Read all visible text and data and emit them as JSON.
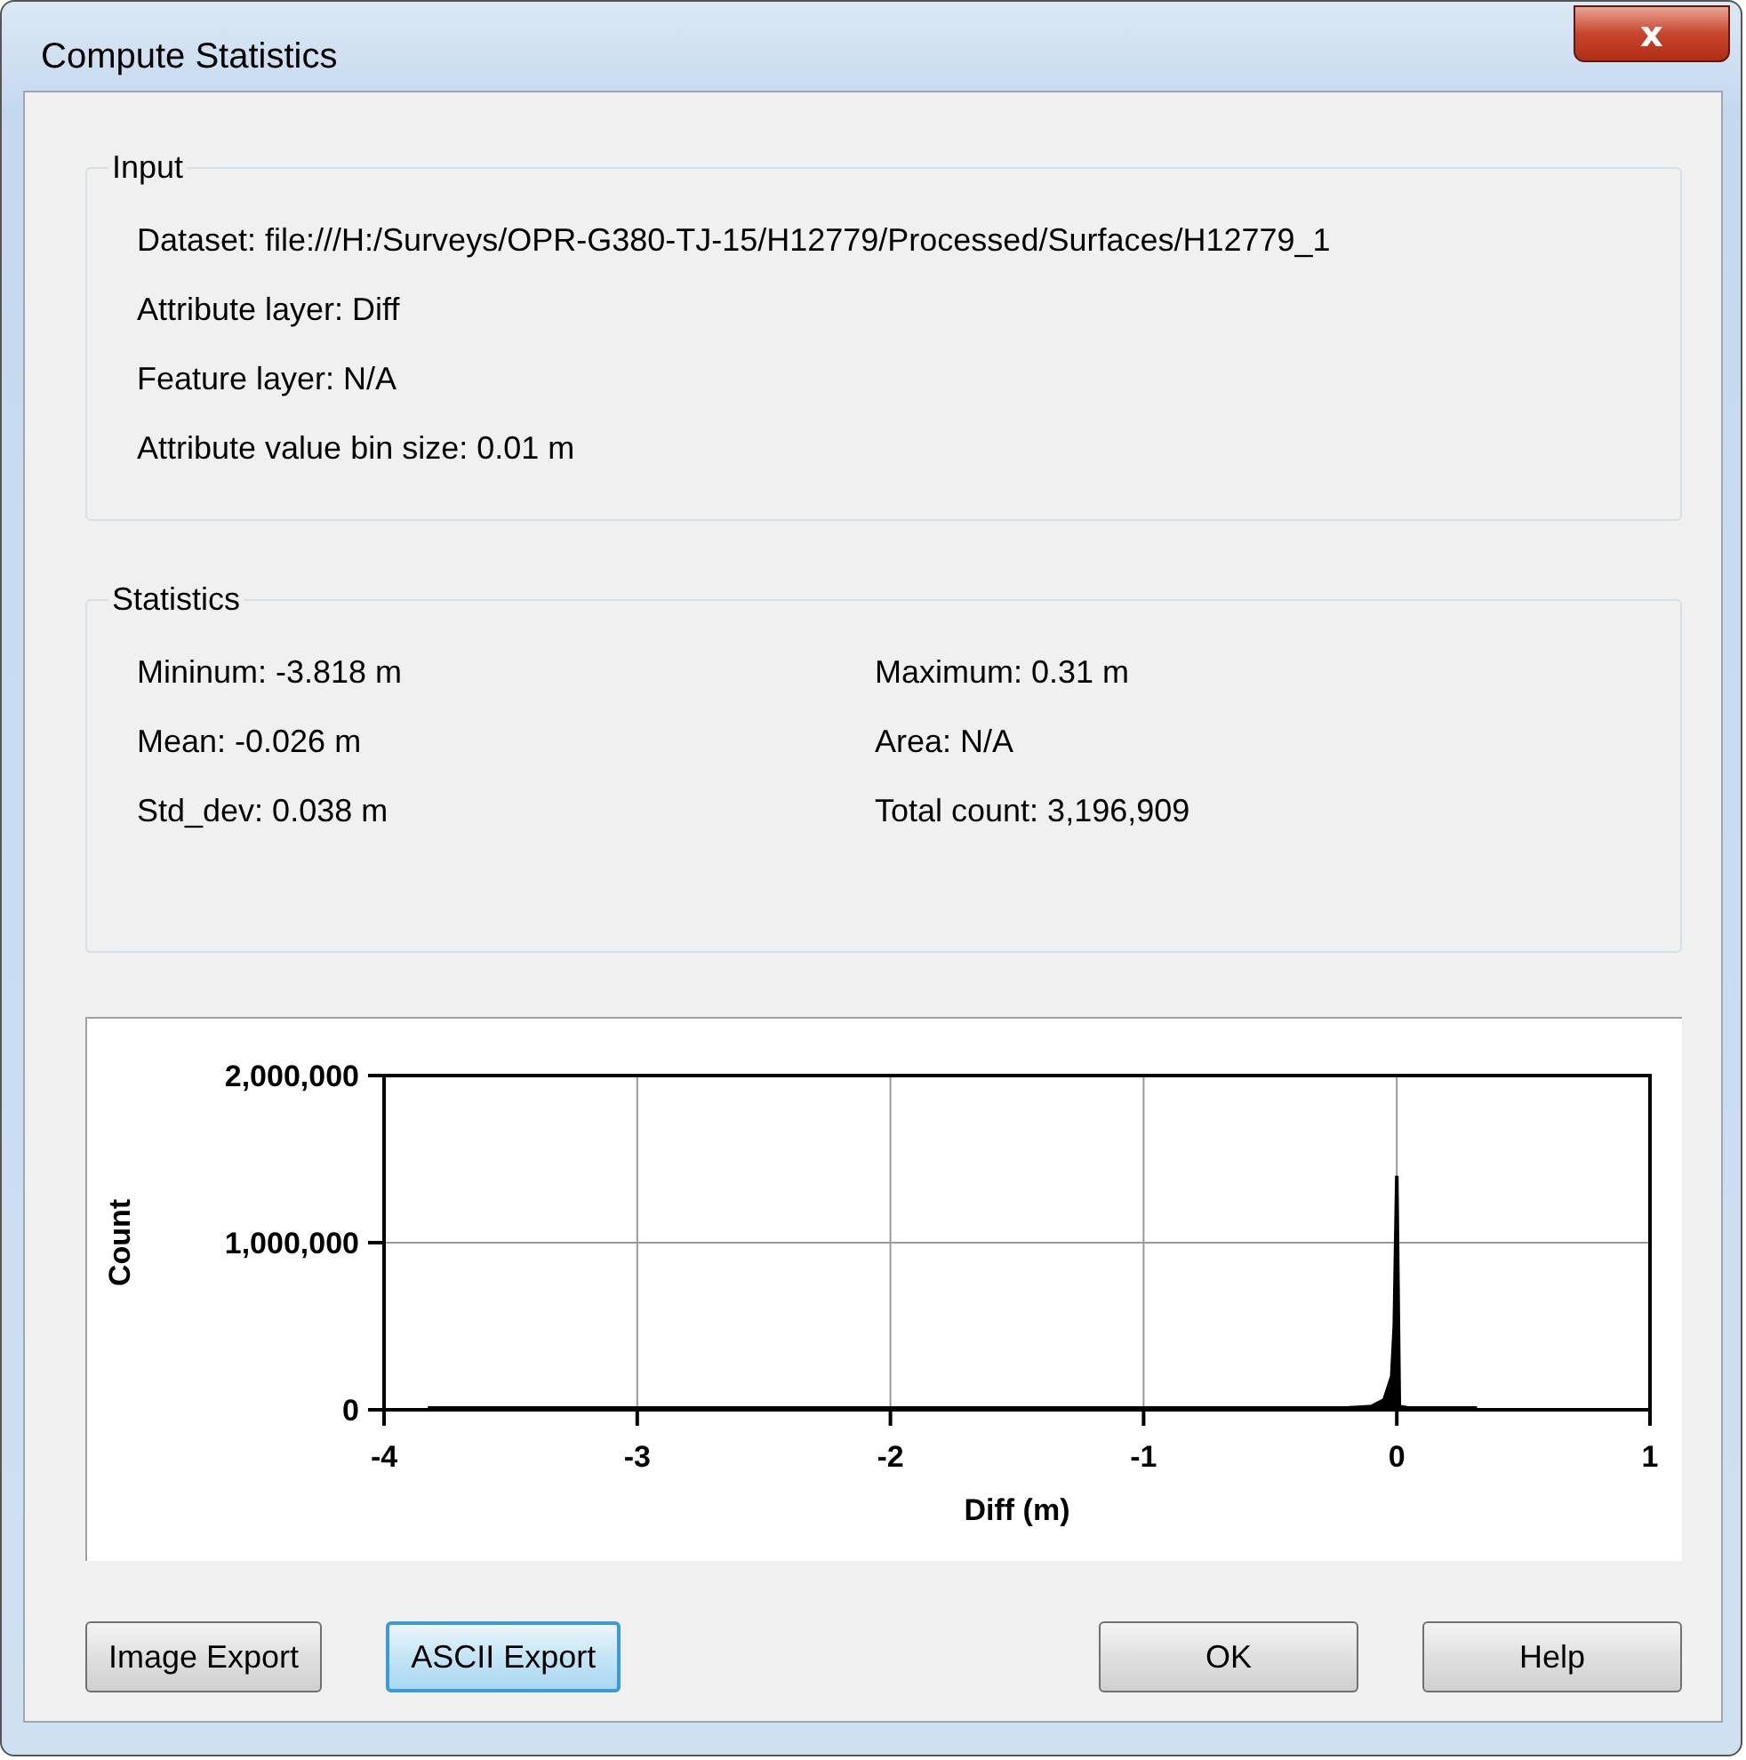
{
  "window": {
    "title": "Compute Statistics",
    "close_label": "x"
  },
  "input": {
    "title": "Input",
    "fields": [
      {
        "label": "Dataset:",
        "value": "file:///H:/Surveys/OPR-G380-TJ-15/H12779/Processed/Surfaces/H12779_1"
      },
      {
        "label": "Attribute layer:",
        "value": "Diff"
      },
      {
        "label": "Feature layer:",
        "value": "N/A"
      },
      {
        "label": "Attribute value bin size:",
        "value": "0.01 m"
      }
    ]
  },
  "statistics": {
    "title": "Statistics",
    "fields": [
      {
        "label": "Mininum:",
        "value": "-3.818 m"
      },
      {
        "label": "Maximum:",
        "value": "0.31 m"
      },
      {
        "label": "Mean:",
        "value": "-0.026 m"
      },
      {
        "label": "Area:",
        "value": "N/A"
      },
      {
        "label": "Std_dev:",
        "value": "0.038 m"
      },
      {
        "label": "Total count:",
        "value": "3,196,909"
      }
    ]
  },
  "histogram": {
    "chart_data": {
      "type": "area",
      "grid": true,
      "xlabel": "Diff (m)",
      "ylabel": "Count",
      "x": [
        -3.82,
        -0.2,
        -0.1,
        -0.05,
        -0.02,
        -0.01,
        0,
        0.01,
        0.05,
        0.31
      ],
      "series": [
        {
          "color": "#000000",
          "values": [
            10000,
            10000,
            20000,
            60000,
            200000,
            500000,
            1400000,
            20000,
            10000,
            10000
          ]
        }
      ],
      "xlim": [
        -4,
        1
      ],
      "ylim": [
        0,
        2000000
      ],
      "xticks": [
        -4,
        -3,
        -2,
        -1,
        0,
        1
      ],
      "yticks": [
        {
          "value": 0,
          "label": "0"
        },
        {
          "value": 1000000,
          "label": "1,000,000"
        },
        {
          "value": 2000000,
          "label": "2,000,000"
        }
      ]
    }
  },
  "buttons_left": [
    {
      "label": "Image Export",
      "focused": false
    },
    {
      "label": "ASCII Export",
      "focused": true
    }
  ],
  "buttons_right": [
    {
      "label": "OK",
      "focused": false
    },
    {
      "label": "Help",
      "focused": false
    }
  ]
}
